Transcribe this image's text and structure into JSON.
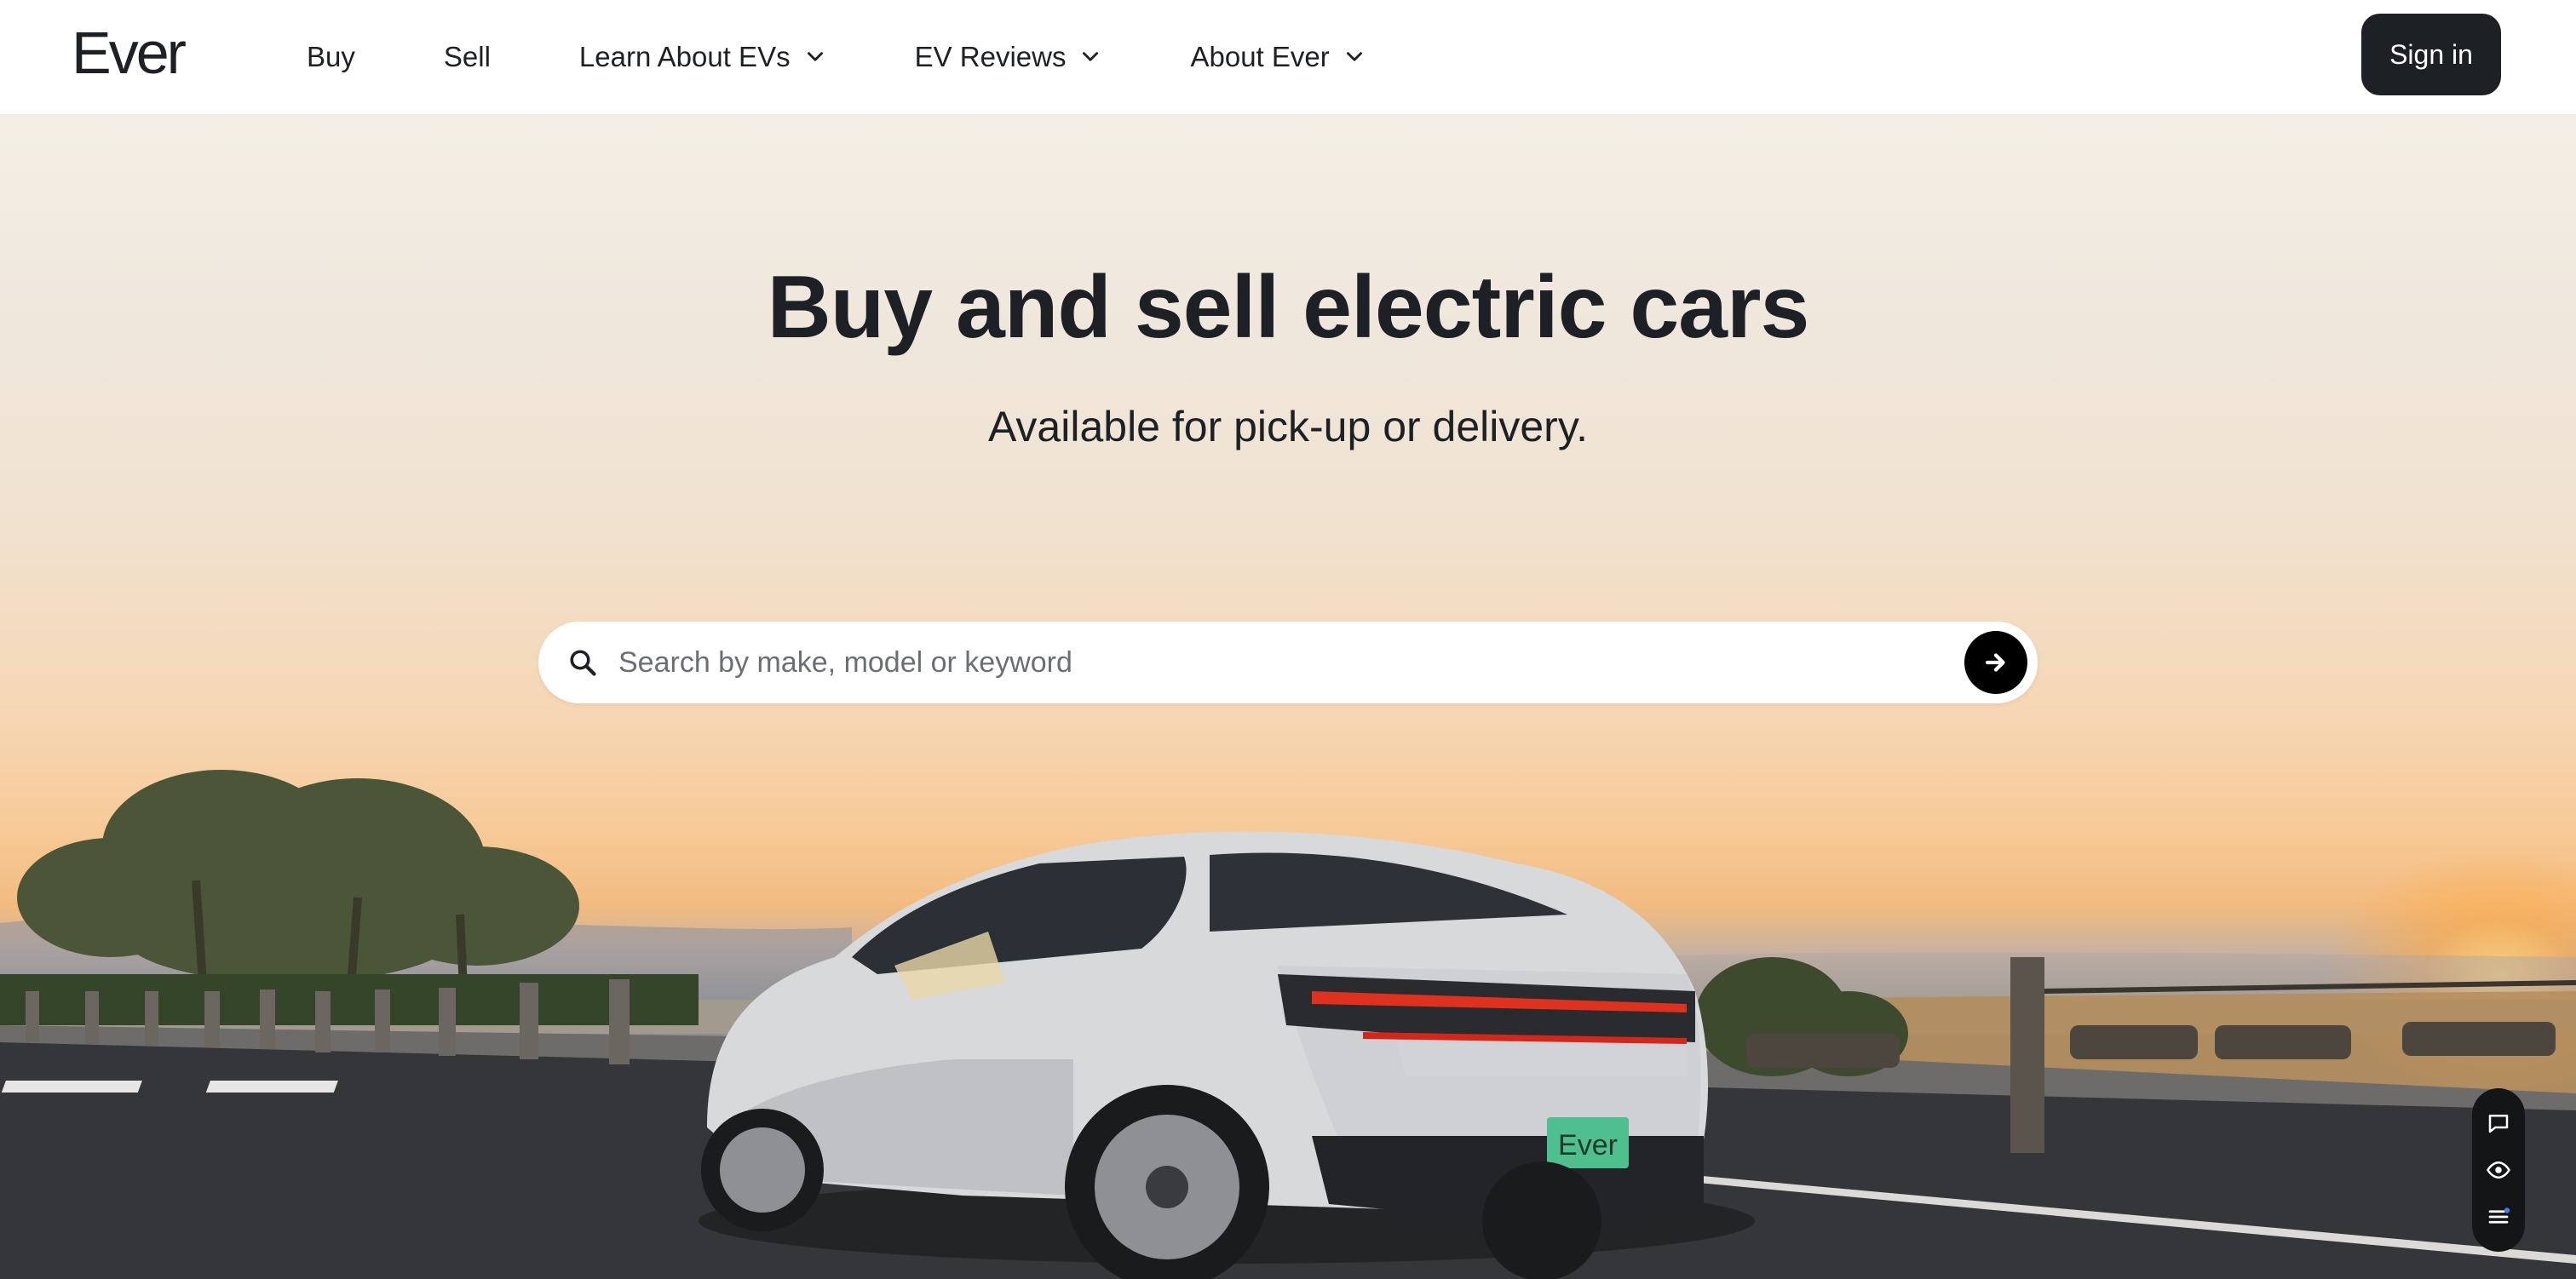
{
  "brand": {
    "logo_text": "Ever"
  },
  "nav": {
    "items": [
      {
        "label": "Buy",
        "has_dropdown": false
      },
      {
        "label": "Sell",
        "has_dropdown": false
      },
      {
        "label": "Learn About EVs",
        "has_dropdown": true
      },
      {
        "label": "EV Reviews",
        "has_dropdown": true
      },
      {
        "label": "About Ever",
        "has_dropdown": true
      }
    ],
    "signin_label": "Sign in"
  },
  "hero": {
    "title": "Buy and sell electric cars",
    "subtitle": "Available for pick-up or delivery."
  },
  "search": {
    "placeholder": "Search by make, model or keyword",
    "value": ""
  },
  "car": {
    "plate_text": "Ever"
  },
  "icons": {
    "search": "search-icon",
    "submit": "arrow-right-icon",
    "dropdown": "chevron-down-icon",
    "widget": [
      "chat-bubble-icon",
      "eye-icon",
      "list-menu-icon"
    ]
  },
  "colors": {
    "text": "#1d2024",
    "signin_bg": "#1d2024",
    "search_button_bg": "#000000",
    "plate": "#4fbf8f"
  }
}
